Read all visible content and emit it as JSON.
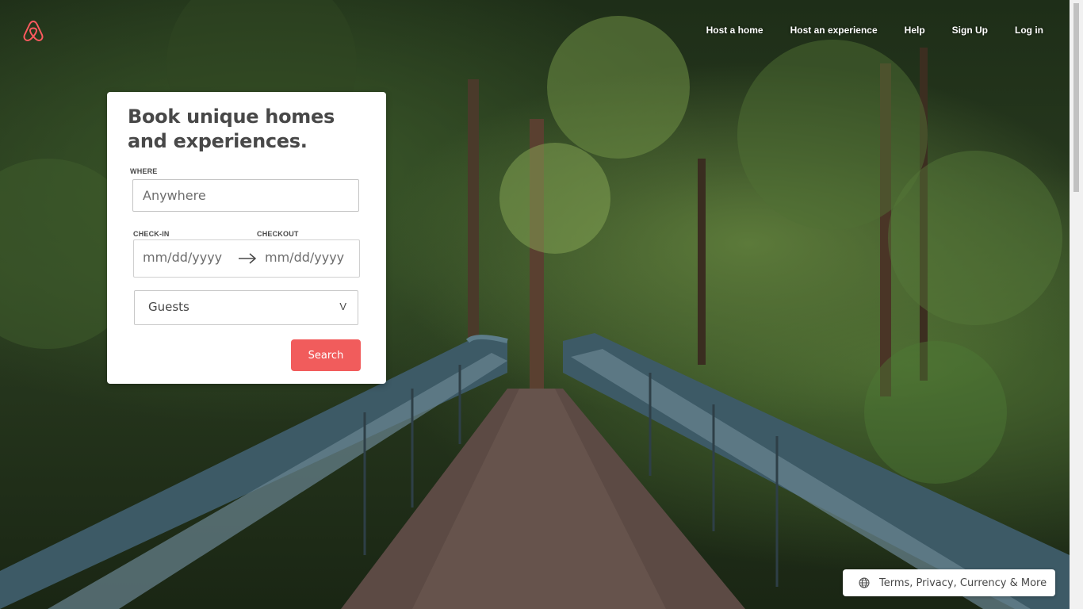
{
  "nav": {
    "host_home": "Host a home",
    "host_experience": "Host an experience",
    "help": "Help",
    "sign_up": "Sign Up",
    "log_in": "Log in"
  },
  "brand": {
    "logo_icon": "airbnb-logo-icon",
    "accent": "#FF5A5F"
  },
  "search_card": {
    "title": "Book unique homes and experiences.",
    "where_label": "WHERE",
    "where_placeholder": "Anywhere",
    "checkin_label": "CHECK-IN",
    "checkout_label": "CHECKOUT",
    "checkin_placeholder": "mm/dd/yyyy",
    "checkout_placeholder": "mm/dd/yyyy",
    "arrow_icon": "arrow-right-icon",
    "guests_label": "Guests",
    "guests_chevron": "V",
    "search_button": "Search",
    "button_color": "#F15C5C"
  },
  "footer": {
    "globe_icon": "globe-icon",
    "text": "Terms, Privacy, Currency & More"
  }
}
